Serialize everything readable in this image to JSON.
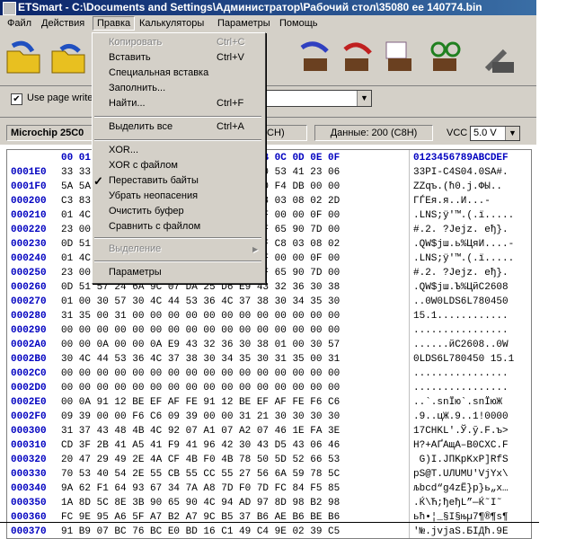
{
  "window": {
    "title": "ETSmart - C:\\Documents and Settings\\Администратор\\Рабочий стол\\35080 ее 140774.bin"
  },
  "menubar": [
    {
      "label": "Файл"
    },
    {
      "label": "Действия"
    },
    {
      "label": "Правка"
    },
    {
      "label": "Калькуляторы"
    },
    {
      "label": "Параметры"
    },
    {
      "label": "Помощь"
    }
  ],
  "options": {
    "use_page_label": "Use page write",
    "combo_value": ""
  },
  "info": {
    "chip": "Microchip 25C0",
    "size_hex": "0CCH)",
    "data_label": "Данные: 200 (C8H)",
    "vcc_label": "VCC",
    "vcc_value": "5.0 V"
  },
  "edit_menu": {
    "items": [
      {
        "label": "Копировать",
        "shortcut": "Ctrl+C",
        "disabled": true
      },
      {
        "label": "Вставить",
        "shortcut": "Ctrl+V",
        "disabled": false
      },
      {
        "label": "Специальная вставка",
        "shortcut": "",
        "disabled": false
      },
      {
        "label": "Заполнить...",
        "shortcut": "",
        "disabled": false
      },
      {
        "label": "Найти...",
        "shortcut": "Ctrl+F",
        "disabled": false
      },
      {
        "label": "Выделить все",
        "shortcut": "Ctrl+A",
        "disabled": false
      },
      {
        "label": "XOR...",
        "shortcut": "",
        "disabled": false
      },
      {
        "label": "XOR с файлом",
        "shortcut": "",
        "disabled": false
      },
      {
        "label": "Переставить байты",
        "shortcut": "",
        "disabled": false
      },
      {
        "label": "Убрать неопасения",
        "shortcut": "",
        "disabled": false
      },
      {
        "label": "Очистить буфер",
        "shortcut": "",
        "disabled": false
      },
      {
        "label": "Сравнить с файлом",
        "shortcut": "",
        "disabled": false
      },
      {
        "label": "Выделение",
        "shortcut": "",
        "disabled": true
      },
      {
        "label": "Параметры",
        "shortcut": "",
        "disabled": false
      }
    ]
  },
  "hex": {
    "header_cols": "00 01 02 03 04 05 06 07 08 09 0A 0B 0C 0D 0E 0F",
    "header_ascii": "0123456789ABCDEF",
    "rows": [
      {
        "addr": "0001E0",
        "bytes": "33 33 50 49 2D 43 34 53 30 34 2E 30 53 41 23 06",
        "ascii": "33PI-C4S04.0SA#."
      },
      {
        "addr": "0001F0",
        "bytes": "5A 5A 66 6E 2E 28 28 30 2E 6A 2E 00 F4 DB 00 00",
        "ascii": "ZZqъ.(ћ0.j.ФЫ.."
      },
      {
        "addr": "000200",
        "bytes": "C3 83 45 A8 41 2E 33 93 C6 94 FF C8 03 08 02 2D",
        "ascii": "ГЃЕя.я..И...-"
      },
      {
        "addr": "000210",
        "bytes": "01 4C 4E 53 3B FF 92 00 00 88 0F BF 00 00 0F 00",
        "ascii": ".LNS;ÿ'™.(.ї....."
      },
      {
        "addr": "000220",
        "bytes": "23 00 32 00 20 3F 4A 65 6A 7A 0A AF 65 90 7D 00",
        "ascii": "#.2. ?Jejz. eђ}."
      },
      {
        "addr": "000230",
        "bytes": "0D 51 57 24 6A 9C 2E 9A 49 4A 65 FF C8 03 08 02",
        "ascii": ".QW$jш.ь%ЦяИ....-"
      },
      {
        "addr": "000240",
        "bytes": "01 4C 4E 53 3B FF 92 00 00 88 0F BF 00 00 0F 00",
        "ascii": ".LNS;ÿ'™.(.ї....."
      },
      {
        "addr": "000250",
        "bytes": "23 00 32 00 20 3F 4A 65 6A 7A 0A AF 65 90 7D 00",
        "ascii": "#.2. ?Jejz. eђ}."
      },
      {
        "addr": "000260",
        "bytes": "0D 51 57 24 6A 9C 07 DA 25 D6 E9 43 32 36 30 38",
        "ascii": ".QW$jш.Ъ%ЦйC2608"
      },
      {
        "addr": "000270",
        "bytes": "01 00 30 57 30 4C 44 53 36 4C 37 38 30 34 35 30",
        "ascii": "..0W0LDS6L780450"
      },
      {
        "addr": "000280",
        "bytes": "31 35 00 31 00 00 00 00 00 00 00 00 00 00 00 00",
        "ascii": "15.1............"
      },
      {
        "addr": "000290",
        "bytes": "00 00 00 00 00 00 00 00 00 00 00 00 00 00 00 00",
        "ascii": "................"
      },
      {
        "addr": "0002A0",
        "bytes": "00 00 0A 00 00 0A E9 43 32 36 30 38 01 00 30 57",
        "ascii": "......йC2608..0W"
      },
      {
        "addr": "0002B0",
        "bytes": "30 4C 44 53 36 4C 37 38 30 34 35 30 31 35 00 31",
        "ascii": "0LDS6L780450 15.1"
      },
      {
        "addr": "0002C0",
        "bytes": "00 00 00 00 00 00 00 00 00 00 00 00 00 00 00 00",
        "ascii": "................"
      },
      {
        "addr": "0002D0",
        "bytes": "00 00 00 00 00 00 00 00 00 00 00 00 00 00 00 00",
        "ascii": "................"
      },
      {
        "addr": "0002E0",
        "bytes": "00 0A 91 12 BE EF AF FE 91 12 BE EF AF FE F6 C6",
        "ascii": "..`.snЇю`.snЇюЖ"
      },
      {
        "addr": "0002F0",
        "bytes": "09 39 00 00 F6 C6 09 39 00 00 31 21 30 30 30 30",
        "ascii": ".9..цЖ.9..1!0000"
      },
      {
        "addr": "000300",
        "bytes": "31 37 43 48 4B 4C 92 07 A1 07 A2 07 46 1E FA 3E",
        "ascii": "17CHKL'.Ў.ў.F.ъ>"
      },
      {
        "addr": "000310",
        "bytes": "CD 3F 2B 41 A5 41 F9 41 96 42 30 43 D5 43 06 46",
        "ascii": "Н?+AҐAщA–B0CХC.F"
      },
      {
        "addr": "000320",
        "bytes": "20 47 29 49 2E 4A CF 4B F0 4B 78 50 5D 52 66 53",
        "ascii": " G)I.JПKрKxP]RfS"
      },
      {
        "addr": "000330",
        "bytes": "70 53 40 54 2E 55 CB 55 CC 55 27 56 6A 59 78 5C",
        "ascii": "pS@T.UЛUМU'VjYx\\"
      },
      {
        "addr": "000340",
        "bytes": "9A 62 F1 64 93 67 34 7A A8 7D F0 7D FC 84 F5 85",
        "ascii": "љbсd“g4zЁ}р}ь„х…"
      },
      {
        "addr": "000350",
        "bytes": "1A 8D 5C 8E 3B 90 65 90 4C 94 AD 97 8D 98 B2 98",
        "ascii": ".Ќ\\Ћ;ђeђL”­—Ќ˜І˜"
      },
      {
        "addr": "000360",
        "bytes": "FC 9E 95 A6 5F A7 B2 A7 9C B5 37 B6 AE B6 BE B6",
        "ascii": "ьћ•¦_§І§њµ7¶®¶ѕ¶"
      },
      {
        "addr": "000370",
        "bytes": "91 B9 07 BC 76 BC E0 BD 16 C1 49 C4 9E 02 39 C5",
        "ascii": "'№.јvјаЅ.БIДћ.9Е"
      }
    ]
  }
}
